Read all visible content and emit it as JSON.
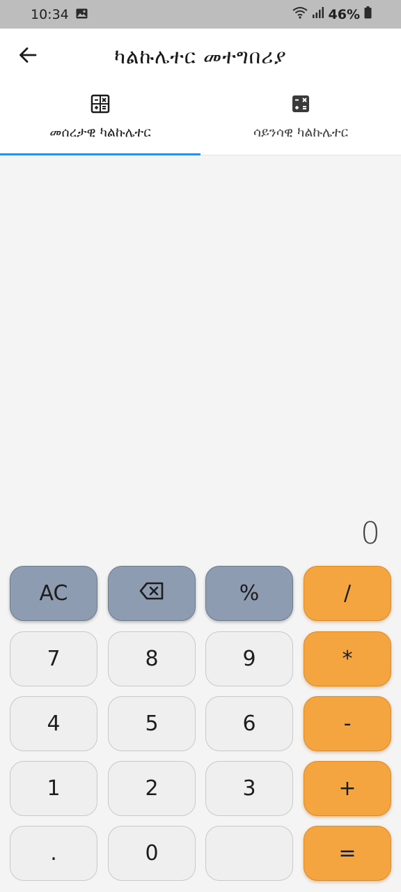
{
  "status_bar": {
    "time": "10:34",
    "battery": "46%",
    "icons": [
      "image-icon",
      "wifi-icon",
      "signal-icon",
      "battery-icon"
    ]
  },
  "app_bar": {
    "title": "ካልኩሌተር መተግበሪያ",
    "back_icon": "arrow-left-icon"
  },
  "tabs": [
    {
      "label": "መሰረታዊ ካልኩሌተር",
      "icon": "calculator-icon",
      "active": true
    },
    {
      "label": "ሳይንሳዊ ካልኩሌተር",
      "icon": "calculator-filled-icon",
      "active": false
    }
  ],
  "display": {
    "value": "0"
  },
  "keypad": {
    "keys": [
      {
        "label": "AC",
        "kind": "fn"
      },
      {
        "label": "",
        "kind": "fn",
        "icon": "backspace-icon"
      },
      {
        "label": "%",
        "kind": "fn"
      },
      {
        "label": "/",
        "kind": "op"
      },
      {
        "label": "7",
        "kind": "num"
      },
      {
        "label": "8",
        "kind": "num"
      },
      {
        "label": "9",
        "kind": "num"
      },
      {
        "label": "*",
        "kind": "op"
      },
      {
        "label": "4",
        "kind": "num"
      },
      {
        "label": "5",
        "kind": "num"
      },
      {
        "label": "6",
        "kind": "num"
      },
      {
        "label": "-",
        "kind": "op"
      },
      {
        "label": "1",
        "kind": "num"
      },
      {
        "label": "2",
        "kind": "num"
      },
      {
        "label": "3",
        "kind": "num"
      },
      {
        "label": "+",
        "kind": "op"
      },
      {
        "label": ".",
        "kind": "num"
      },
      {
        "label": "0",
        "kind": "num"
      },
      {
        "label": "",
        "kind": "num"
      },
      {
        "label": "=",
        "kind": "op"
      }
    ]
  },
  "colors": {
    "accent": "#2f8fe0",
    "operator": "#f5a540",
    "function": "#8e9cb2",
    "number": "#efefef"
  }
}
